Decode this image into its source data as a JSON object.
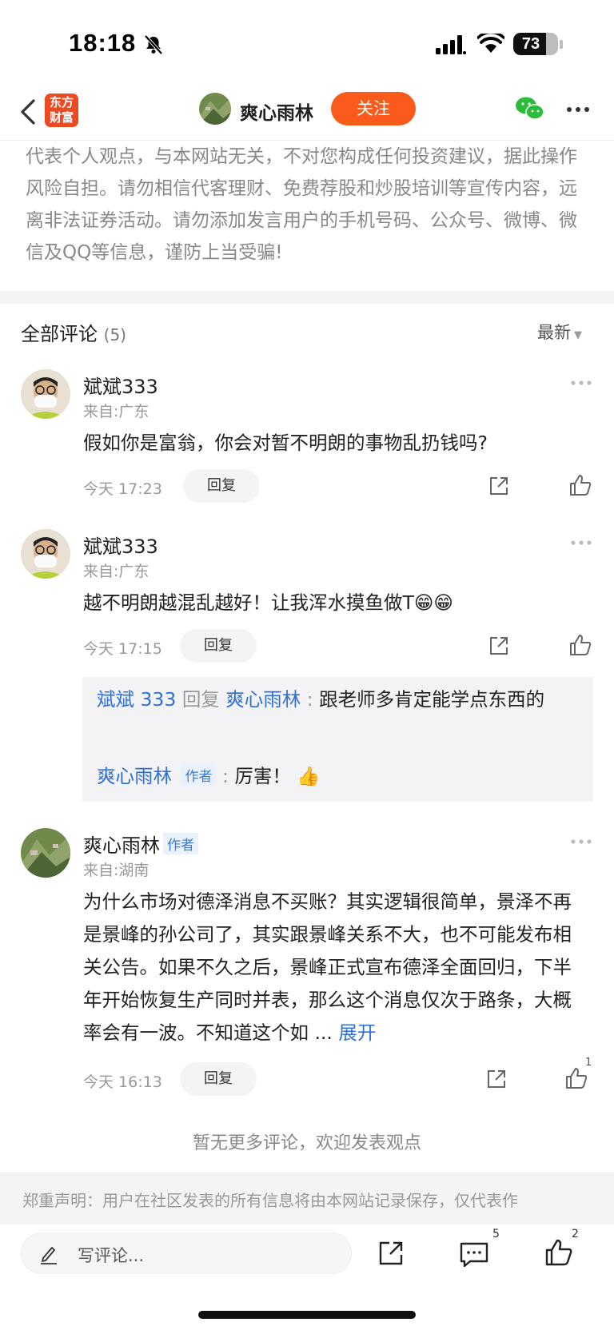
{
  "status_bar": {
    "time": "18:18",
    "battery": "73",
    "battery_level": 0.73,
    "icons": [
      "bell-slash-icon",
      "cellular-signal-icon",
      "wifi-icon",
      "battery-icon"
    ]
  },
  "header": {
    "app_logo_line1": "东方",
    "app_logo_line2": "财富",
    "username": "爽心雨林",
    "follow_label": "关注",
    "icons": [
      "back-chevron-icon",
      "wechat-icon",
      "more-dots-icon"
    ],
    "colors": {
      "accent": "#fa5a1a",
      "logo": "#ee4a22"
    }
  },
  "disclaimer_top": "代表个人观点，与本网站无关，不对您构成任何投资建议，据此操作风险自担。请勿相信代客理财、免费荐股和炒股培训等宣传内容，远离非法证券活动。请勿添加发言用户的手机号码、公众号、微博、微信及QQ等信息，谨防上当受骗!",
  "comments_header": {
    "title": "全部评论",
    "count": "(5)",
    "sort_label": "最新"
  },
  "comments": [
    {
      "name": "斌斌333",
      "location": "来自:广东",
      "text": "假如你是富翁，你会对暂不明朗的事物乱扔钱吗?",
      "time": "今天 17:23",
      "reply_label": "回复"
    },
    {
      "name": "斌斌333",
      "location": "来自:广东",
      "text": "越不明朗越混乱越好！让我浑水摸鱼做T😁😁",
      "time": "今天 17:15",
      "reply_label": "回复",
      "sub_replies": [
        {
          "from": "斌斌 333",
          "reply_word": "回复",
          "to": "爽心雨林",
          "text": "跟老师多肯定能学点东西的"
        },
        {
          "from": "爽心雨林",
          "tag": "作者",
          "text": "厉害！ 👍"
        }
      ]
    },
    {
      "name": "爽心雨林",
      "tag": "作者",
      "location": "来自:湖南",
      "text": "为什么市场对德泽消息不买账？其实逻辑很简单，景泽不再是景峰的孙公司了，其实跟景峰关系不大，也不可能发布相关公告。如果不久之后，景峰正式宣布德泽全面回归，下半年开始恢复生产同时并表，那么这个消息仅次于路条，大概率会有一波。不知道这个如 ...",
      "expand_label": "展开",
      "time": "今天 16:13",
      "reply_label": "回复",
      "likes": "1"
    }
  ],
  "no_more": "暂无更多评论，欢迎发表观点",
  "disclaimer_bottom": "郑重声明：用户在社区发表的所有信息将由本网站记录保存，仅代表作",
  "bottom_bar": {
    "write_placeholder": "写评论...",
    "comment_count": "5",
    "like_count": "2"
  }
}
